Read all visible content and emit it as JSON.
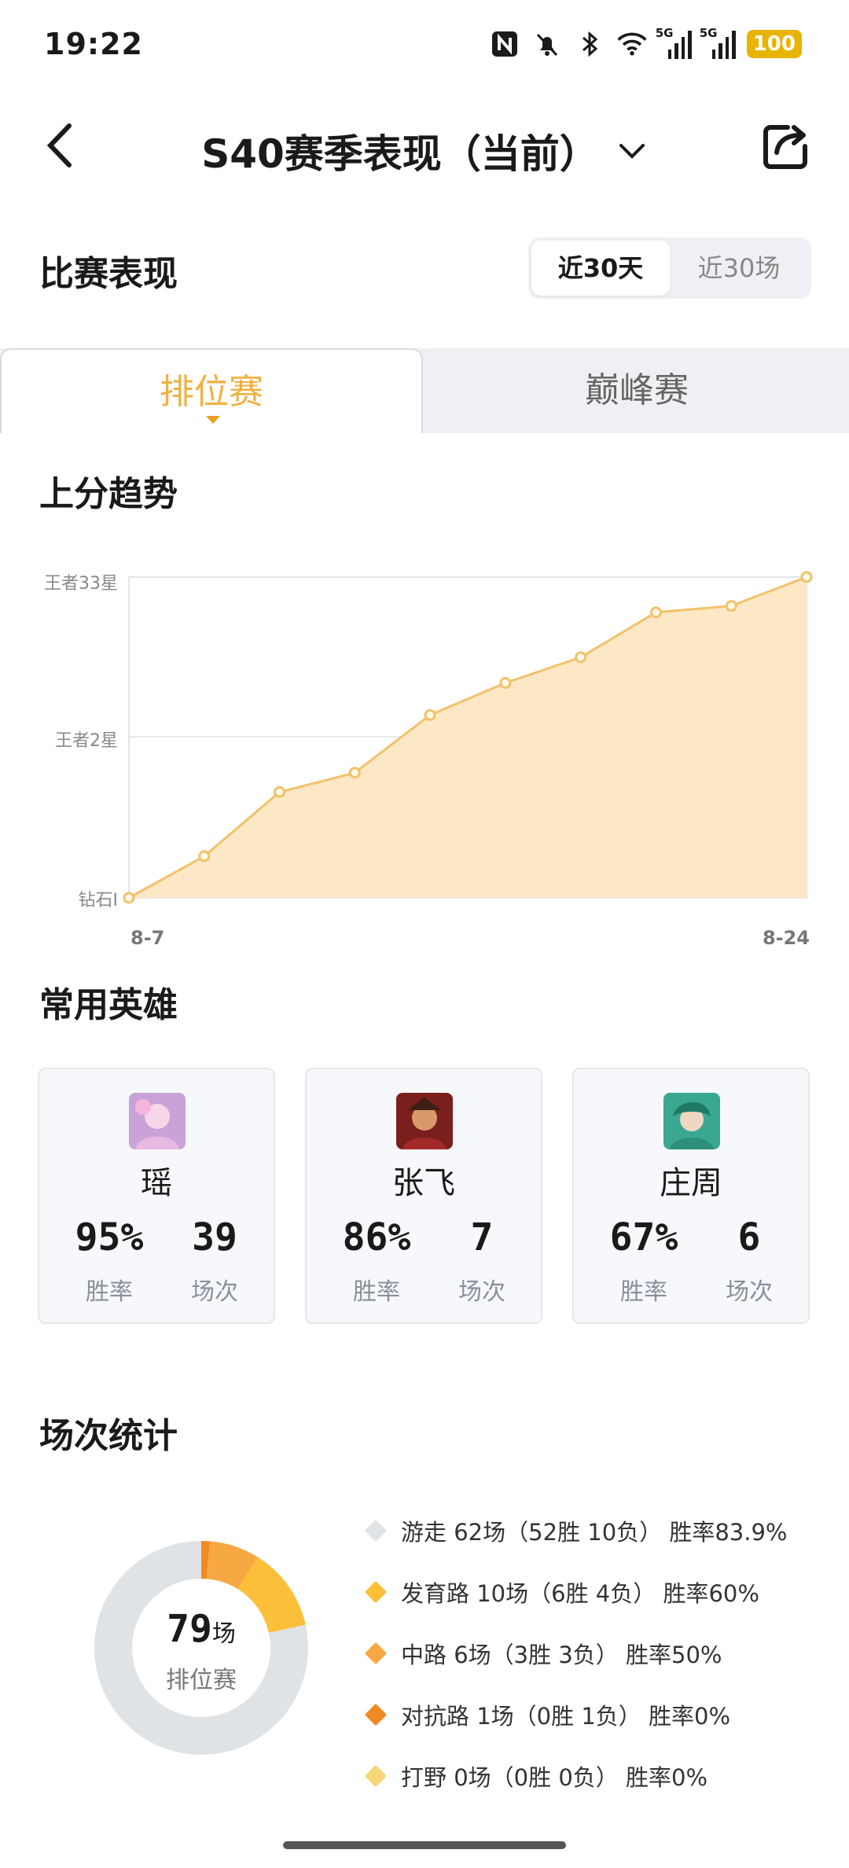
{
  "status_bar": {
    "time": "19:22",
    "net1": "5G",
    "net2": "5G",
    "battery": "100"
  },
  "header": {
    "title": "S40赛季表现（当前）"
  },
  "performance": {
    "title": "比赛表现",
    "filters": [
      "近30天",
      "近30场"
    ],
    "selected_filter": "近30天"
  },
  "mode_tabs": [
    {
      "label": "排位赛",
      "active": true
    },
    {
      "label": "巅峰赛",
      "active": false
    }
  ],
  "trend": {
    "title": "上分趋势",
    "chart_data": {
      "type": "area",
      "y_tick_labels": [
        "钻石I",
        "王者2星",
        "王者33星"
      ],
      "x_tick_labels": [
        "8-7",
        "8-24"
      ],
      "y_range": [
        0,
        100
      ],
      "values": [
        0,
        13,
        33,
        39,
        57,
        67,
        75,
        89,
        91,
        100
      ],
      "colors": {
        "line": "#f3c16a",
        "fill": "#fde8c6",
        "point": "#fffbe8"
      }
    }
  },
  "heroes": {
    "title": "常用英雄",
    "items": [
      {
        "name": "瑶",
        "win_rate": "95%",
        "win_rate_label": "胜率",
        "games": "39",
        "games_label": "场次"
      },
      {
        "name": "张飞",
        "win_rate": "86%",
        "win_rate_label": "胜率",
        "games": "7",
        "games_label": "场次"
      },
      {
        "name": "庄周",
        "win_rate": "67%",
        "win_rate_label": "胜率",
        "games": "6",
        "games_label": "场次"
      }
    ]
  },
  "match_stats": {
    "title": "场次统计",
    "total": "79",
    "total_unit": "场",
    "mode_label": "排位赛",
    "lanes": [
      {
        "text": "游走 62场（52胜 10负） 胜率83.9%",
        "color": "#dfe3e6",
        "games": 62
      },
      {
        "text": "发育路 10场（6胜 4负） 胜率60%",
        "color": "#fbbf3a",
        "games": 10
      },
      {
        "text": "中路 6场（3胜 3负） 胜率50%",
        "color": "#f8a843",
        "games": 6
      },
      {
        "text": "对抗路 1场（0胜 1负） 胜率0%",
        "color": "#f08a24",
        "games": 1
      },
      {
        "text": "打野 0场（0胜 0负） 胜率0%",
        "color": "#f8d77a",
        "games": 0
      }
    ]
  }
}
